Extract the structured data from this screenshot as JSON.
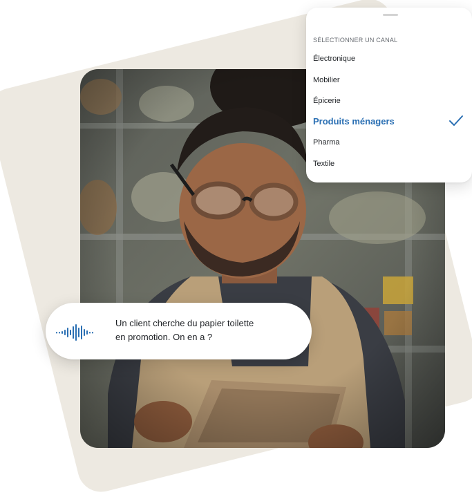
{
  "channel_selector": {
    "heading": "SÉLECTIONNER UN CANAL",
    "options": [
      {
        "label": "Électronique",
        "selected": false
      },
      {
        "label": "Mobilier",
        "selected": false
      },
      {
        "label": "Épicerie",
        "selected": false
      },
      {
        "label": "Produits ménagers",
        "selected": true
      },
      {
        "label": "Pharma",
        "selected": false
      },
      {
        "label": "Textile",
        "selected": false
      }
    ],
    "selected_icon": "checkmark-icon",
    "accent_color": "#2a6fb3"
  },
  "voice_query": {
    "icon": "sound-wave-icon",
    "lines": [
      "Un client cherche du papier toilette",
      "en promotion. On en a ?"
    ]
  },
  "colors": {
    "backdrop": "#ede9e1",
    "wave": "#2a6fb3"
  }
}
